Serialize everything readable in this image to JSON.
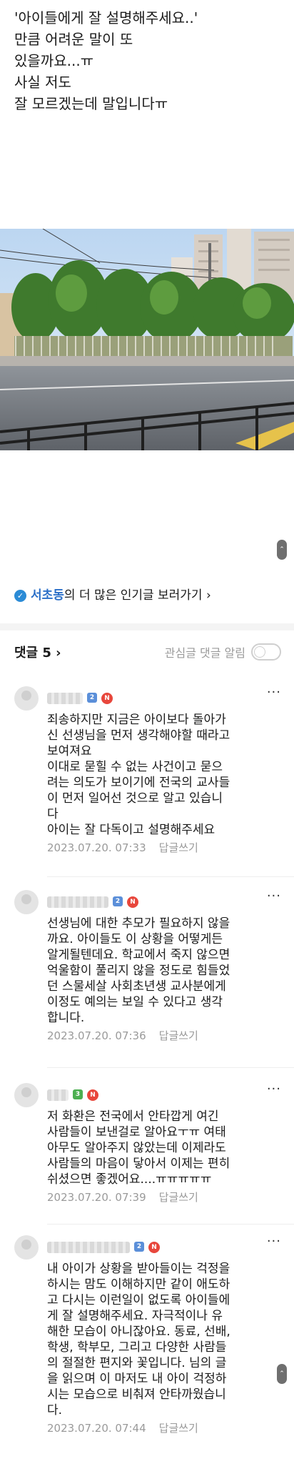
{
  "post": {
    "lines": [
      "'아이들에게 잘 설명해주세요..'",
      "만큼 어려운 말이 또",
      "있을까요...ㅠ",
      "사실 저도",
      "잘 모르겠는데 말입니다ㅠ"
    ]
  },
  "more_link": {
    "badge": "✓",
    "place": "서초동",
    "text": "의 더 많은 인기글 보러가기 ›"
  },
  "comments_header": {
    "count_label": "댓글 5 ›",
    "alert_label": "관심글 댓글 알림"
  },
  "comments": [
    {
      "level": "2",
      "new_badge": "N",
      "lines": [
        "죄송하지만 지금은 아이보다 돌아가",
        "신 선생님을 먼저 생각해야할 때라고",
        "보여져요",
        "이대로 묻힐 수 없는 사건이고 묻으",
        "려는 의도가 보이기에 전국의 교사들",
        "이 먼저 일어선 것으로 알고 있습니",
        "다",
        "아이는 잘 다독이고 설명해주세요"
      ],
      "date": "2023.07.20. 07:33",
      "reply": "답글쓰기"
    },
    {
      "level": "2",
      "new_badge": "N",
      "lines": [
        "선생님에 대한 추모가 필요하지 않을",
        "까요. 아이들도 이 상황을 어떻게든",
        "알게될텐데요. 학교에서 죽지 않으면",
        "억울함이 풀리지 않을 정도로 힘들었",
        "던 스물세살 사회초년생 교사분에게",
        "이정도 예의는 보일 수 있다고 생각",
        "합니다."
      ],
      "date": "2023.07.20. 07:36",
      "reply": "답글쓰기"
    },
    {
      "level": "3",
      "new_badge": "N",
      "lines": [
        "저 화환은 전국에서 안타깝게 여긴",
        "사람들이 보낸걸로 알아요ㅜㅠ 여태",
        "아무도 알아주지 않았는데 이제라도",
        "사람들의 마음이 닿아서 이제는 편히",
        "쉬셨으면 좋겠어요....ㅠㅠㅠㅠㅠ"
      ],
      "date": "2023.07.20. 07:39",
      "reply": "답글쓰기"
    },
    {
      "level": "2",
      "new_badge": "N",
      "lines": [
        "내 아이가 상황을 받아들이는 걱정을",
        "하시는 맘도 이해하지만 같이 애도하",
        "고 다시는 이런일이 없도록 아이들에",
        "게 잘 설명해주세요. 자극적이나 유",
        "해한 모습이 아니잖아요. 동료, 선배,",
        "학생, 학부모, 그리고 다양한 사람들",
        "의 절절한 편지와 꽃입니다. 님의 글",
        "을 읽으며 이 마저도 내 아이 걱정하",
        "시는 모습으로 비춰져 안타까웠습니",
        "다."
      ],
      "date": "2023.07.20. 07:44",
      "reply": "답글쓰기"
    }
  ],
  "colors": {
    "accent_blue": "#2b6fc8",
    "new_badge_red": "#e8473c",
    "level_blue": "#5b8fd9",
    "level_green": "#4caf50",
    "meta_gray": "#9a9a9a"
  }
}
